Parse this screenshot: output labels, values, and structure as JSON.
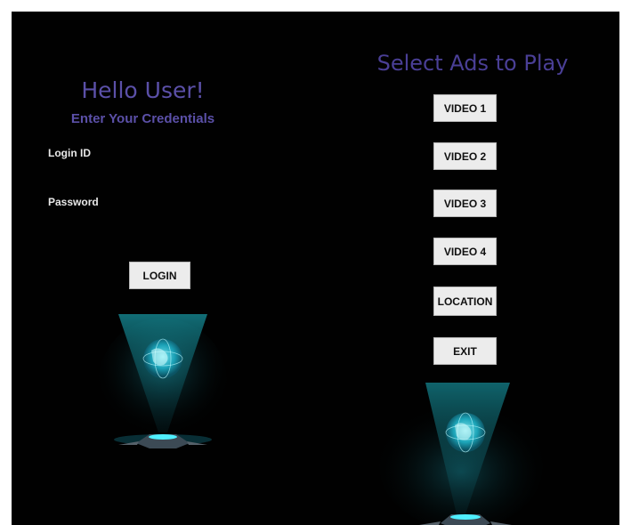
{
  "login_panel": {
    "title": "Hello User!",
    "subtitle": "Enter Your Credentials",
    "login_id_label": "Login ID",
    "password_label": "Password",
    "login_button": "LOGIN"
  },
  "ads_panel": {
    "title": "Select Ads to Play",
    "buttons": [
      "VIDEO 1",
      "VIDEO 2",
      "VIDEO 3",
      "VIDEO 4",
      "LOCATION",
      "EXIT"
    ]
  },
  "colors": {
    "background": "#010101",
    "title_purple": "#5b50a8",
    "hologram_cyan": "#29d8e8",
    "button_bg": "#ececec"
  },
  "icons": [
    "globe-hologram-icon",
    "hologram-projector-icon"
  ]
}
